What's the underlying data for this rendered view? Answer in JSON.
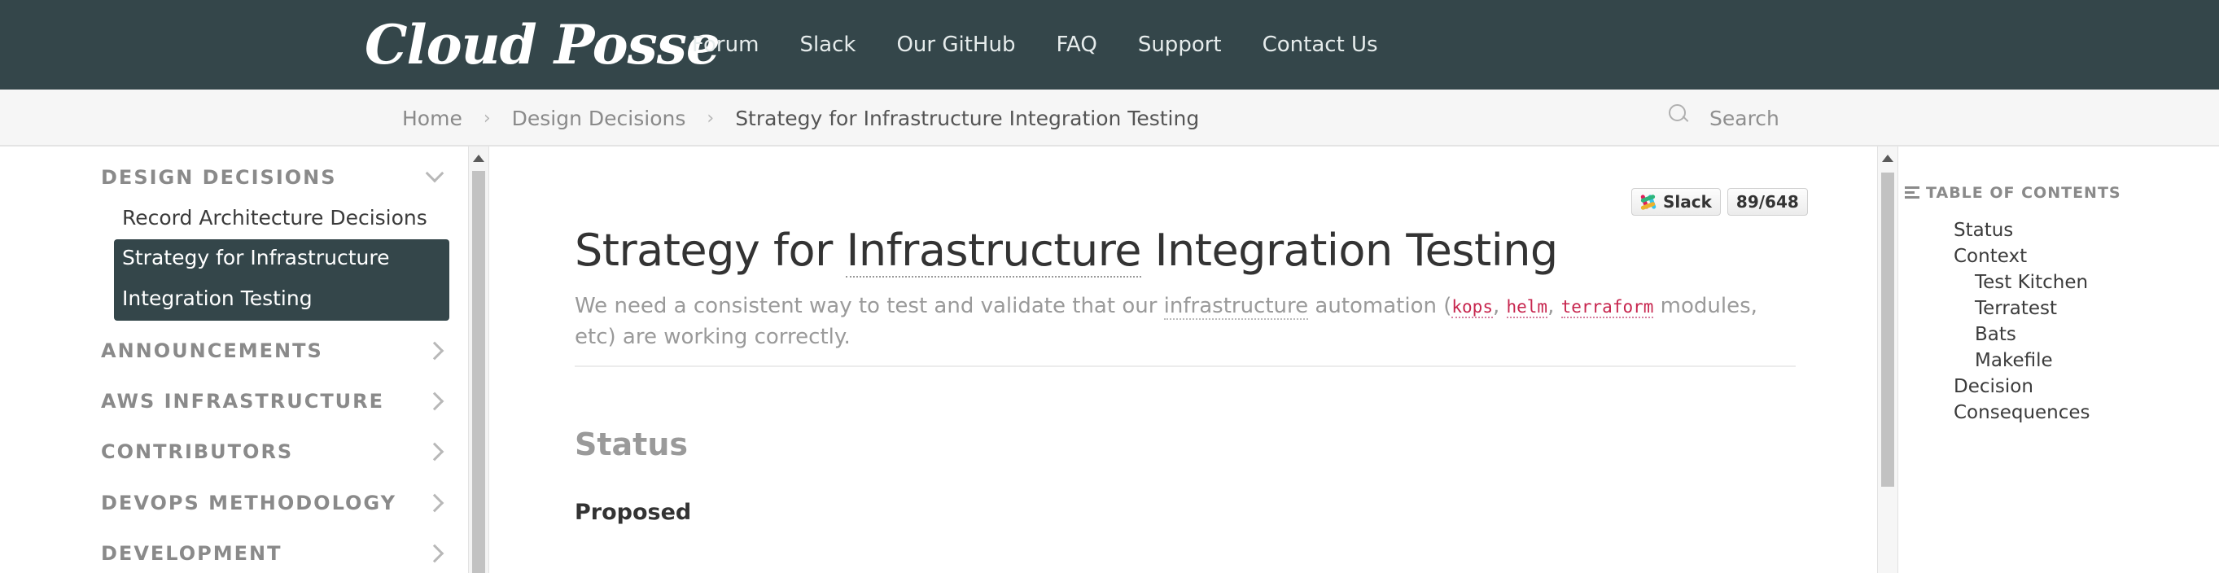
{
  "brand": {
    "logo_text": "Cloud Posse"
  },
  "nav": {
    "items": [
      "Forum",
      "Slack",
      "Our GitHub",
      "FAQ",
      "Support",
      "Contact Us"
    ]
  },
  "breadcrumb": {
    "items": [
      "Home",
      "Design Decisions",
      "Strategy for Infrastructure Integration Testing"
    ],
    "separator": "›"
  },
  "search": {
    "placeholder": "Search"
  },
  "sidebar": {
    "sections": [
      {
        "label": "DESIGN DECISIONS",
        "expanded": true,
        "icon": "chevron-down-icon"
      },
      {
        "label": "ANNOUNCEMENTS",
        "icon": "chevron-right-icon"
      },
      {
        "label": "AWS INFRASTRUCTURE",
        "icon": "chevron-right-icon"
      },
      {
        "label": "CONTRIBUTORS",
        "icon": "chevron-right-icon"
      },
      {
        "label": "DEVOPS METHODOLOGY",
        "icon": "chevron-right-icon"
      },
      {
        "label": "DEVELOPMENT",
        "icon": "chevron-right-icon"
      }
    ],
    "sub_items": [
      "Record Architecture Decisions"
    ],
    "active_item": {
      "line1": "Strategy for Infrastructure",
      "line2": "Integration Testing"
    }
  },
  "badges": {
    "slack_label": "Slack",
    "slack_count": "89/648"
  },
  "article": {
    "title_pre": "Strategy for ",
    "title_abbr": "Infrastructure",
    "title_post": " Integration Testing",
    "lead_pre": "We need a consistent way to test and validate that our ",
    "lead_abbr": "infrastructure",
    "lead_mid": " automation (",
    "code1": "kops",
    "comma1": ", ",
    "code2": "helm",
    "comma2": ", ",
    "code3": "terraform",
    "lead_post": " modules, etc) are working correctly.",
    "status_heading": "Status",
    "status_value": "Proposed"
  },
  "toc": {
    "heading": "TABLE OF CONTENTS",
    "items": [
      "Status",
      "Context",
      "Test Kitchen",
      "Terratest",
      "Bats",
      "Makefile",
      "Decision",
      "Consequences"
    ]
  },
  "colors": {
    "header_bg": "#34464a",
    "active_bg": "#34464a",
    "code": "#c7254e"
  }
}
